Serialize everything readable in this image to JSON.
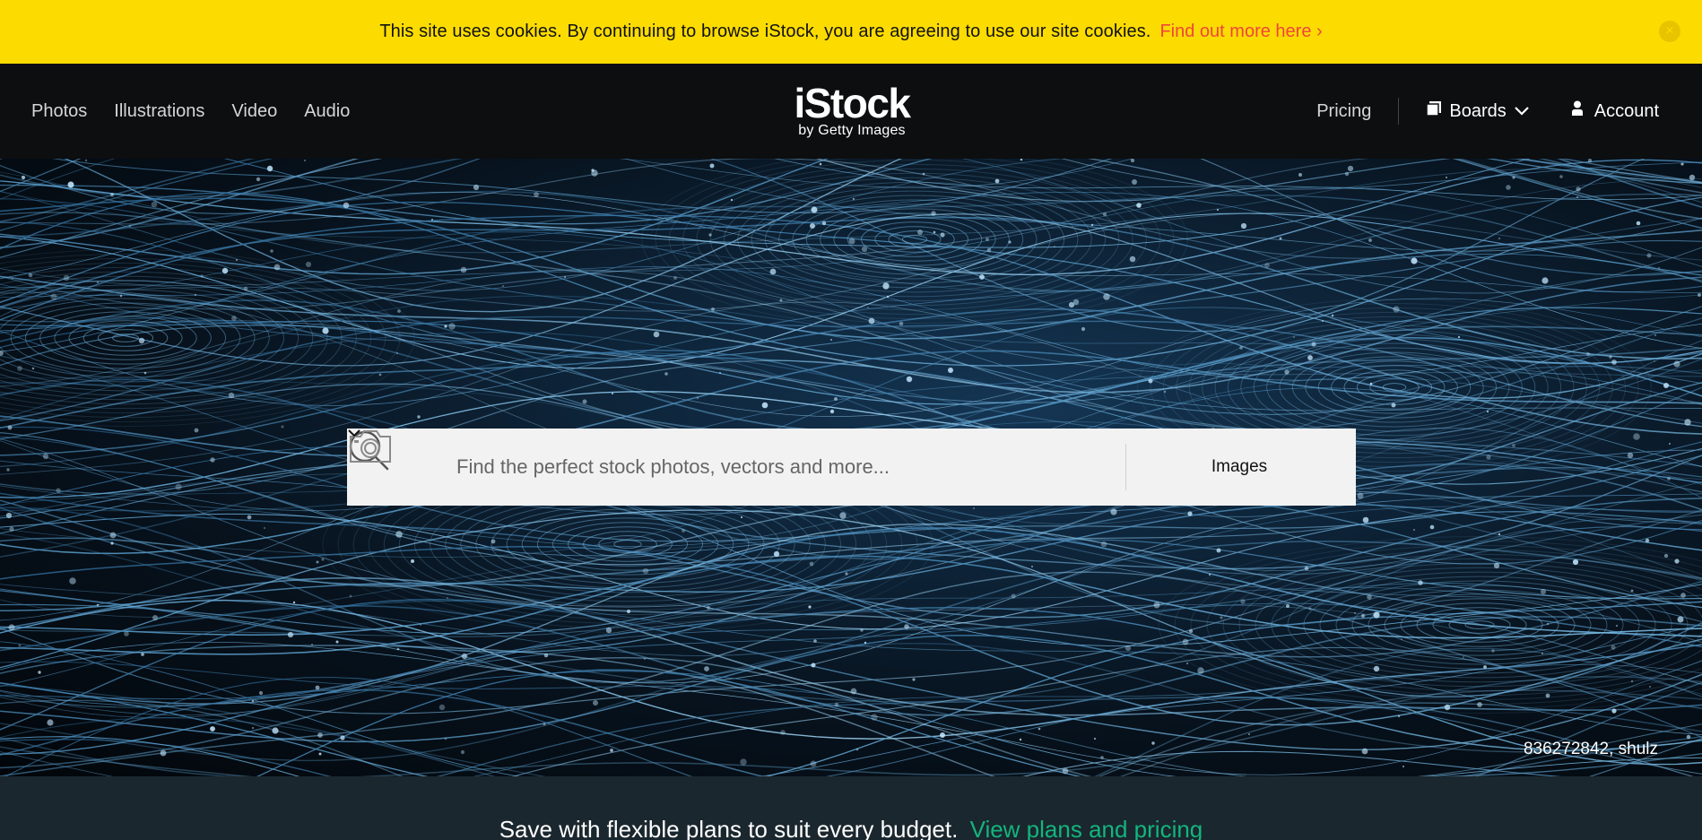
{
  "cookie_banner": {
    "message": "This site uses cookies. By continuing to browse iStock, you are agreeing to use our site cookies.",
    "link_label": "Find out more here ›",
    "close_glyph": "×"
  },
  "nav": {
    "left_items": [
      {
        "label": "Photos"
      },
      {
        "label": "Illustrations"
      },
      {
        "label": "Video"
      },
      {
        "label": "Audio"
      }
    ],
    "logo_main": "iStock",
    "logo_sub": "by Getty Images",
    "pricing_label": "Pricing",
    "boards_label": "Boards",
    "account_label": "Account"
  },
  "search": {
    "placeholder": "Find the perfect stock photos, vectors and more...",
    "type_label": "Images"
  },
  "hero": {
    "credit": "836272842, shulz"
  },
  "promo": {
    "text": "Save with flexible plans to suit every budget.",
    "link_label": "View plans and pricing"
  },
  "colors": {
    "banner_yellow": "#fcdc00",
    "banner_link": "#f0453c",
    "nav_bg": "#0c0e10",
    "promo_link": "#13b57e"
  }
}
